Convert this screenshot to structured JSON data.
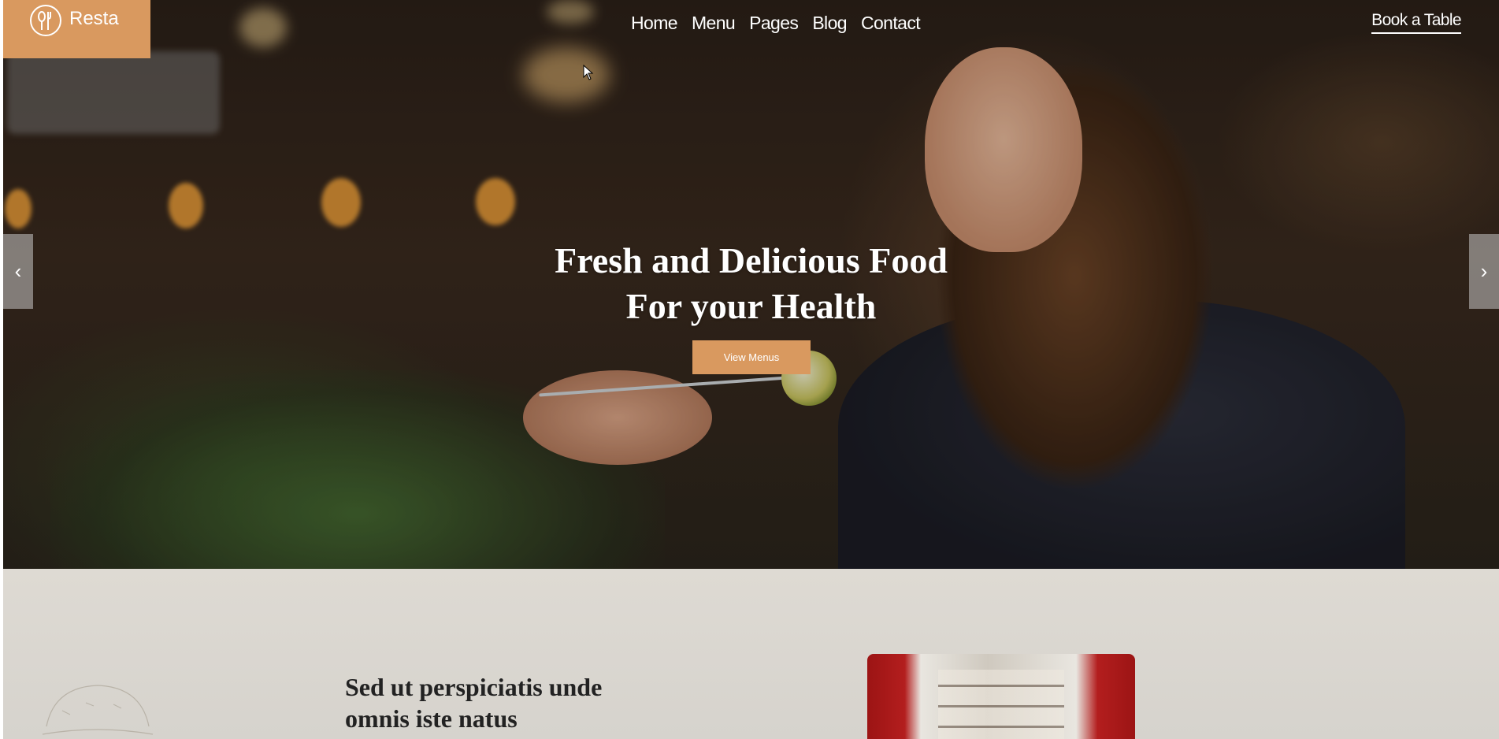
{
  "header": {
    "logo_text": "Resta",
    "logo_icon": "fork-spoon-icon",
    "nav": [
      {
        "label": "Home"
      },
      {
        "label": "Menu"
      },
      {
        "label": "Pages"
      },
      {
        "label": "Blog"
      },
      {
        "label": "Contact"
      }
    ],
    "book_label": "Book a Table"
  },
  "hero": {
    "title_line1": "Fresh and Delicious Food",
    "title_line2": "For your Health",
    "cta_label": "View Menus",
    "prev_icon": "chevron-left-icon",
    "next_icon": "chevron-right-icon"
  },
  "about": {
    "heading_line1": "Sed ut perspiciatis unde",
    "heading_line2": "omnis iste natus"
  },
  "colors": {
    "accent": "#d9995f",
    "section_bg": "#dedad3",
    "text_dark": "#222222"
  }
}
